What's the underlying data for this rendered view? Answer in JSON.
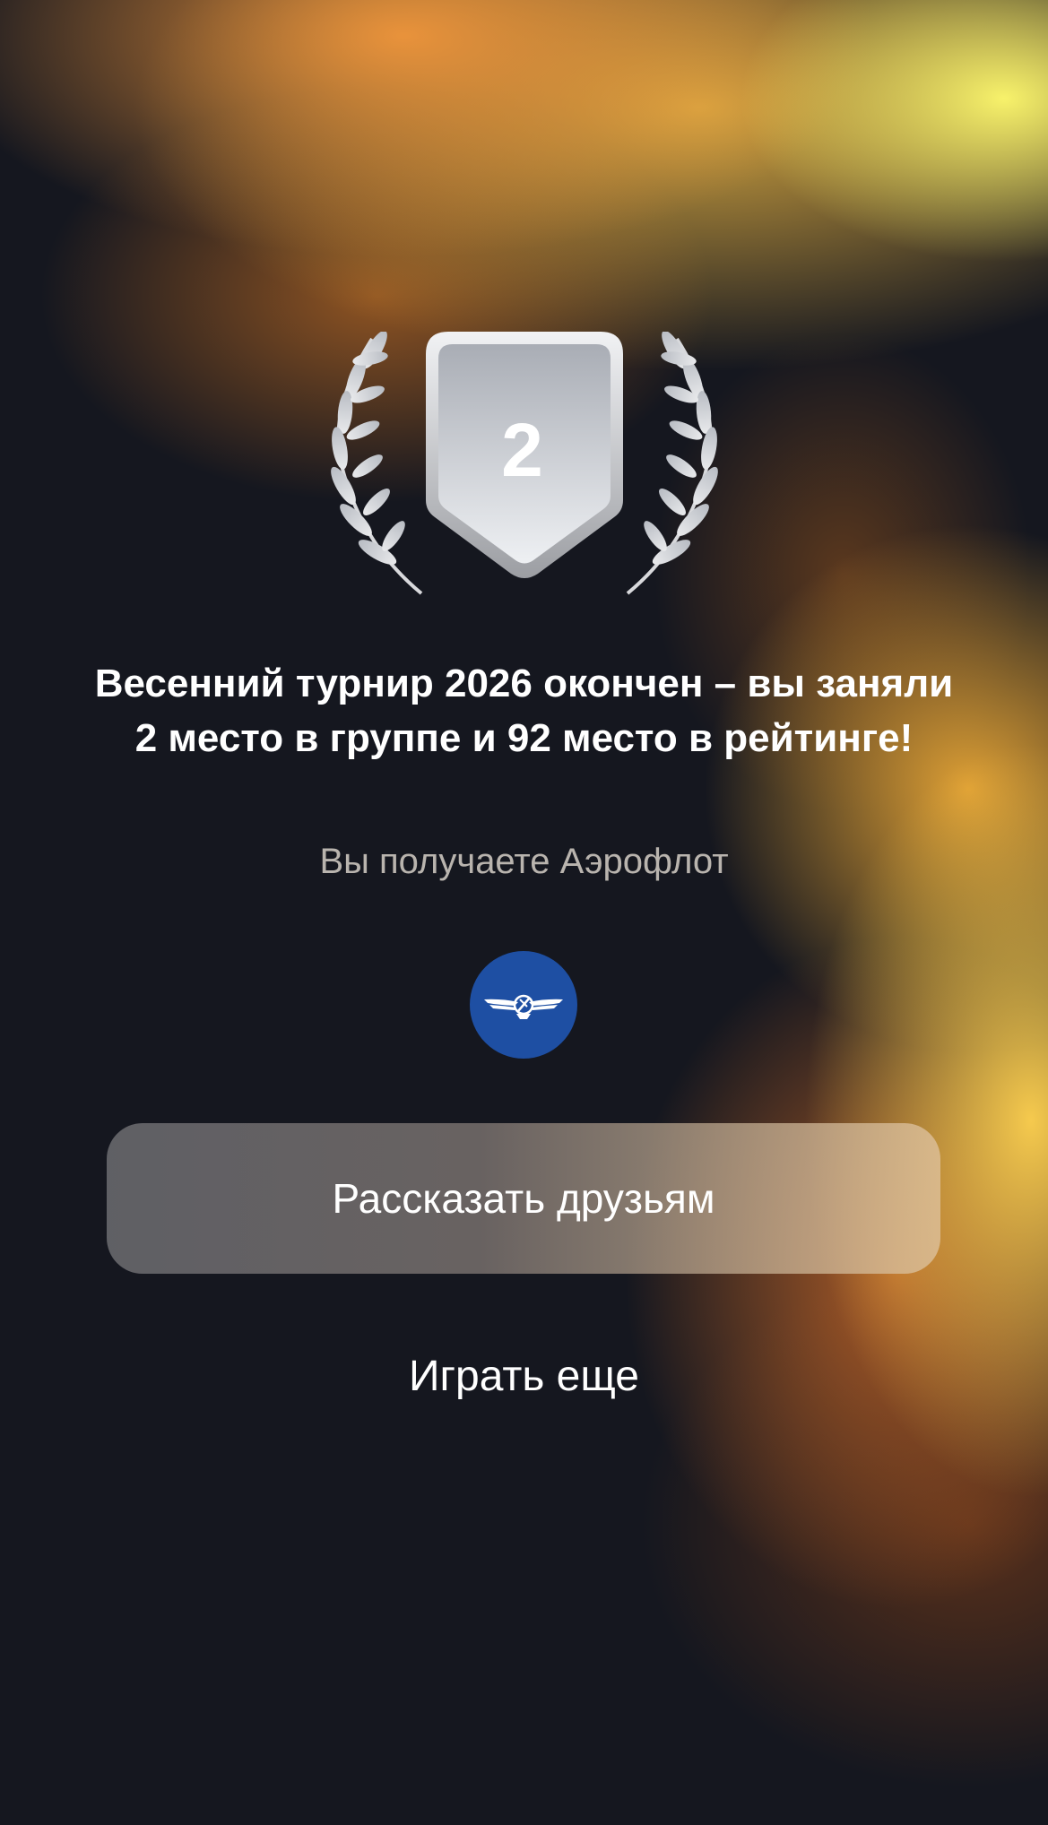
{
  "result": {
    "place": "2",
    "title": "Весенний турнир 2026 окончен – вы заняли 2 место в группе и 92 место в рейтинге!",
    "subtitle": "Вы получаете Аэрофлот",
    "badge_icon": "laurel-shield-badge",
    "reward_logo": "aeroflot-logo"
  },
  "actions": {
    "share_label": "Рассказать друзьям",
    "play_again_label": "Играть еще"
  },
  "colors": {
    "background": "#15171f",
    "accent_orange": "#f0a040",
    "accent_yellow": "#fff36e",
    "logo_blue": "#1e4fa3",
    "subtitle_gray": "#b9b4ae"
  }
}
